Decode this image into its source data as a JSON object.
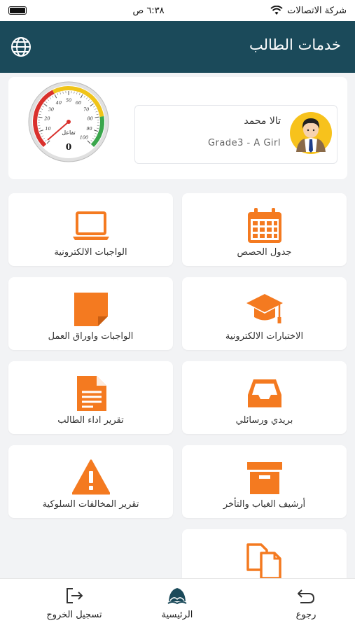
{
  "status_bar": {
    "carrier": "شركة الاتصالات",
    "time": "٦:٣٨ ص"
  },
  "header": {
    "title": "خدمات الطالب",
    "language_icon": "globe-icon"
  },
  "student": {
    "name": "تالا محمد",
    "grade": "Grade3 - A Girl"
  },
  "gauge": {
    "label": "تفاعل",
    "value": "0",
    "ticks": [
      "10",
      "20",
      "30",
      "40",
      "50",
      "60",
      "70",
      "80",
      "90",
      "100"
    ]
  },
  "tiles": [
    {
      "label": "جدول الحصص",
      "icon": "calendar-icon"
    },
    {
      "label": "الواجبات الالكترونية",
      "icon": "laptop-icon"
    },
    {
      "label": "الاختبارات الالكترونية",
      "icon": "graduation-cap-icon"
    },
    {
      "label": "الواجبات واوراق العمل",
      "icon": "note-icon"
    },
    {
      "label": "بريدي ورسائلي",
      "icon": "inbox-icon"
    },
    {
      "label": "تقرير اداء الطالب",
      "icon": "document-icon"
    },
    {
      "label": "أرشيف الغياب والتأخر",
      "icon": "archive-box-icon"
    },
    {
      "label": "تقرير المخالفات السلوكية",
      "icon": "warning-icon"
    },
    {
      "label": "",
      "icon": "copy-files-icon"
    }
  ],
  "bottom_nav": {
    "back": "رجوع",
    "home": "الرئيسية",
    "logout": "تسجيل الخروج"
  },
  "colors": {
    "header": "#1b4a5a",
    "accent": "#f47a20"
  }
}
